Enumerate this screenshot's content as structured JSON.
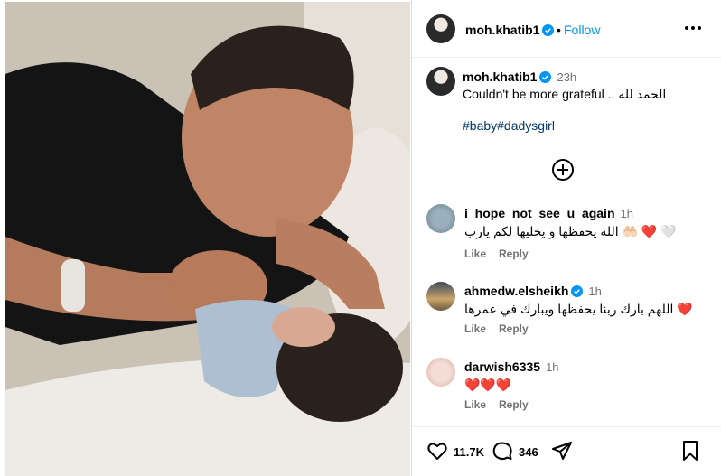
{
  "post": {
    "username": "moh.khatib1",
    "follow_label": "Follow",
    "dot": "•",
    "caption_time": "23h",
    "caption_text": "Couldn't be more grateful .. الحمد لله",
    "caption_tags": "#baby#dadysgirl"
  },
  "comments": [
    {
      "username": "i_hope_not_see_u_again",
      "time": "1h",
      "text": "الله يحفظها و يخليها لكم يارب 🤲🏻 ❤️ 🤍",
      "like": "Like",
      "reply": "Reply"
    },
    {
      "username": "ahmedw.elsheikh",
      "time": "1h",
      "text": "اللهم بارك ربنا يحفظها ويبارك في عمرها ❤️",
      "like": "Like",
      "reply": "Reply"
    },
    {
      "username": "darwish6335",
      "time": "1h",
      "text": "❤️❤️❤️",
      "like": "Like",
      "reply": "Reply"
    },
    {
      "username": "darwish6335",
      "time": "",
      "text": "",
      "like": "",
      "reply": ""
    }
  ],
  "actions": {
    "likes": "11.7K",
    "comments": "346"
  },
  "colors": {
    "accent": "#0095f6",
    "heart": "#ed1c3c",
    "hashtag": "#00376b"
  },
  "icons": [
    "verified-badge-icon",
    "more-icon",
    "add-comment-icon",
    "heart-icon",
    "comment-icon",
    "share-icon",
    "bookmark-icon"
  ]
}
